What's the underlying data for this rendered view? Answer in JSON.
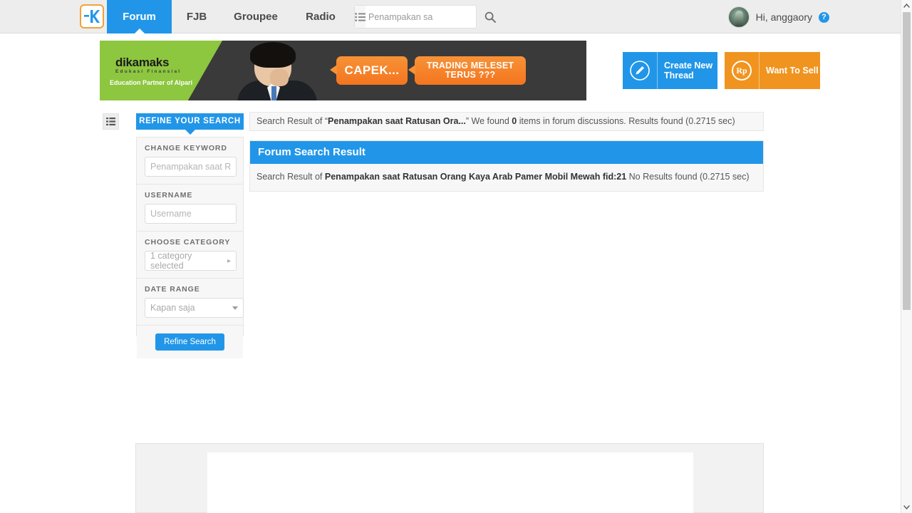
{
  "nav": {
    "logo": "kaskus-logo",
    "tabs": [
      {
        "label": "Forum",
        "active": true
      },
      {
        "label": "FJB",
        "active": false
      },
      {
        "label": "Groupee",
        "active": false
      },
      {
        "label": "Radio",
        "active": false
      }
    ],
    "search": {
      "value": "Penampakan sa",
      "placeholder": "Penampakan sa",
      "category_icon": "list-icon",
      "submit_icon": "search-icon"
    },
    "user": {
      "greeting": "Hi, anggaory",
      "help_icon_label": "?",
      "avatar": "user-avatar"
    }
  },
  "banner": {
    "brand": "dikamaks",
    "brand_sub": "Edukasi Finansial",
    "tagline": "Education Partner of Alpari",
    "bubble1": "CAPEK...",
    "bubble2": "TRADING MELESET TERUS ???"
  },
  "actions": {
    "create_thread": {
      "label": "Create New Thread",
      "icon": "pencil-icon",
      "color": "#2196e8"
    },
    "want_to_sell": {
      "label": "Want To Sell",
      "icon": "rupiah-icon",
      "color": "#f0941f"
    }
  },
  "sidebar": {
    "toggle_icon": "list-toggle-icon",
    "header": "REFINE YOUR SEARCH",
    "fields": [
      {
        "label": "CHANGE KEYWORD",
        "value": "Penampakan saat Ra",
        "placeholder": "Penampakan saat Ra",
        "type": "text"
      },
      {
        "label": "USERNAME",
        "value": "",
        "placeholder": "Username",
        "type": "text"
      },
      {
        "label": "CHOOSE CATEGORY",
        "value": "1 category selected",
        "type": "flyout"
      },
      {
        "label": "DATE RANGE",
        "value": "Kapan saja",
        "type": "dropdown"
      }
    ],
    "submit_label": "Refine Search"
  },
  "result_bar": {
    "prefix": "Search Result of “",
    "query": "Penampakan saat Ratusan Ora...",
    "middle": "” We found ",
    "count": "0",
    "suffix": " items in forum discussions. Results found (0.2715 sec)"
  },
  "result_panel": {
    "title": "Forum Search Result",
    "body_prefix": "Search Result of ",
    "body_query": "Penampakan saat Ratusan Orang Kaya Arab Pamer Mobil Mewah fid:21",
    "body_suffix": " No Results found (0.2715 sec)"
  },
  "bottom_ad": {
    "placeholder": ""
  },
  "scrollbar": {
    "up_arrow": "chevron-up-icon",
    "down_arrow": "chevron-down-icon"
  },
  "colors": {
    "accent_blue": "#2196e8",
    "accent_orange": "#f0941f",
    "banner_green": "#8dc63f",
    "page_bg": "#ffffff",
    "nav_bg": "#ededed"
  }
}
